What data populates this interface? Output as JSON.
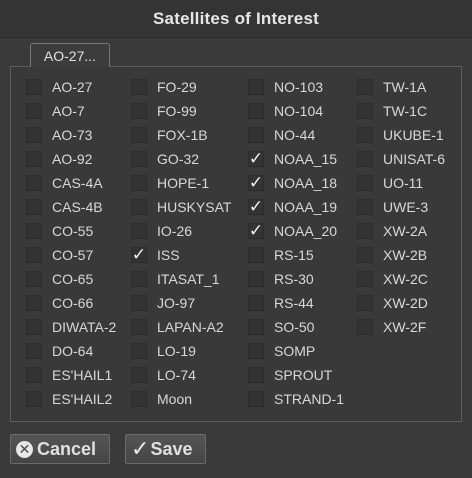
{
  "window": {
    "title": "Satellites of Interest"
  },
  "tab": {
    "label": "AO-27..."
  },
  "columns": [
    {
      "items": [
        {
          "label": "AO-27",
          "checked": false
        },
        {
          "label": "AO-7",
          "checked": false
        },
        {
          "label": "AO-73",
          "checked": false
        },
        {
          "label": "AO-92",
          "checked": false
        },
        {
          "label": "CAS-4A",
          "checked": false
        },
        {
          "label": "CAS-4B",
          "checked": false
        },
        {
          "label": "CO-55",
          "checked": false
        },
        {
          "label": "CO-57",
          "checked": false
        },
        {
          "label": "CO-65",
          "checked": false
        },
        {
          "label": "CO-66",
          "checked": false
        },
        {
          "label": "DIWATA-2",
          "checked": false
        },
        {
          "label": "DO-64",
          "checked": false
        },
        {
          "label": "ES'HAIL1",
          "checked": false
        },
        {
          "label": "ES'HAIL2",
          "checked": false
        }
      ]
    },
    {
      "items": [
        {
          "label": "FO-29",
          "checked": false
        },
        {
          "label": "FO-99",
          "checked": false
        },
        {
          "label": "FOX-1B",
          "checked": false
        },
        {
          "label": "GO-32",
          "checked": false
        },
        {
          "label": "HOPE-1",
          "checked": false
        },
        {
          "label": "HUSKYSAT",
          "checked": false
        },
        {
          "label": "IO-26",
          "checked": false
        },
        {
          "label": "ISS",
          "checked": true
        },
        {
          "label": "ITASAT_1",
          "checked": false
        },
        {
          "label": "JO-97",
          "checked": false
        },
        {
          "label": "LAPAN-A2",
          "checked": false
        },
        {
          "label": "LO-19",
          "checked": false
        },
        {
          "label": "LO-74",
          "checked": false
        },
        {
          "label": "Moon",
          "checked": false
        }
      ]
    },
    {
      "items": [
        {
          "label": "NO-103",
          "checked": false
        },
        {
          "label": "NO-104",
          "checked": false
        },
        {
          "label": "NO-44",
          "checked": false
        },
        {
          "label": "NOAA_15",
          "checked": true
        },
        {
          "label": "NOAA_18",
          "checked": true
        },
        {
          "label": "NOAA_19",
          "checked": true
        },
        {
          "label": "NOAA_20",
          "checked": true
        },
        {
          "label": "RS-15",
          "checked": false
        },
        {
          "label": "RS-30",
          "checked": false
        },
        {
          "label": "RS-44",
          "checked": false
        },
        {
          "label": "SO-50",
          "checked": false
        },
        {
          "label": "SOMP",
          "checked": false
        },
        {
          "label": "SPROUT",
          "checked": false
        },
        {
          "label": "STRAND-1",
          "checked": false
        }
      ]
    },
    {
      "items": [
        {
          "label": "TW-1A",
          "checked": false
        },
        {
          "label": "TW-1C",
          "checked": false
        },
        {
          "label": "UKUBE-1",
          "checked": false
        },
        {
          "label": "UNISAT-6",
          "checked": false
        },
        {
          "label": "UO-11",
          "checked": false
        },
        {
          "label": "UWE-3",
          "checked": false
        },
        {
          "label": "XW-2A",
          "checked": false
        },
        {
          "label": "XW-2B",
          "checked": false
        },
        {
          "label": "XW-2C",
          "checked": false
        },
        {
          "label": "XW-2D",
          "checked": false
        },
        {
          "label": "XW-2F",
          "checked": false
        }
      ]
    }
  ],
  "check_glyph": "✓",
  "buttons": {
    "cancel_label": "Cancel",
    "cancel_icon": "close-circle-icon",
    "save_label": "Save",
    "save_icon": "checkmark-icon"
  },
  "colors": {
    "background": "#3a3a3a",
    "text": "#d8d8d8"
  }
}
